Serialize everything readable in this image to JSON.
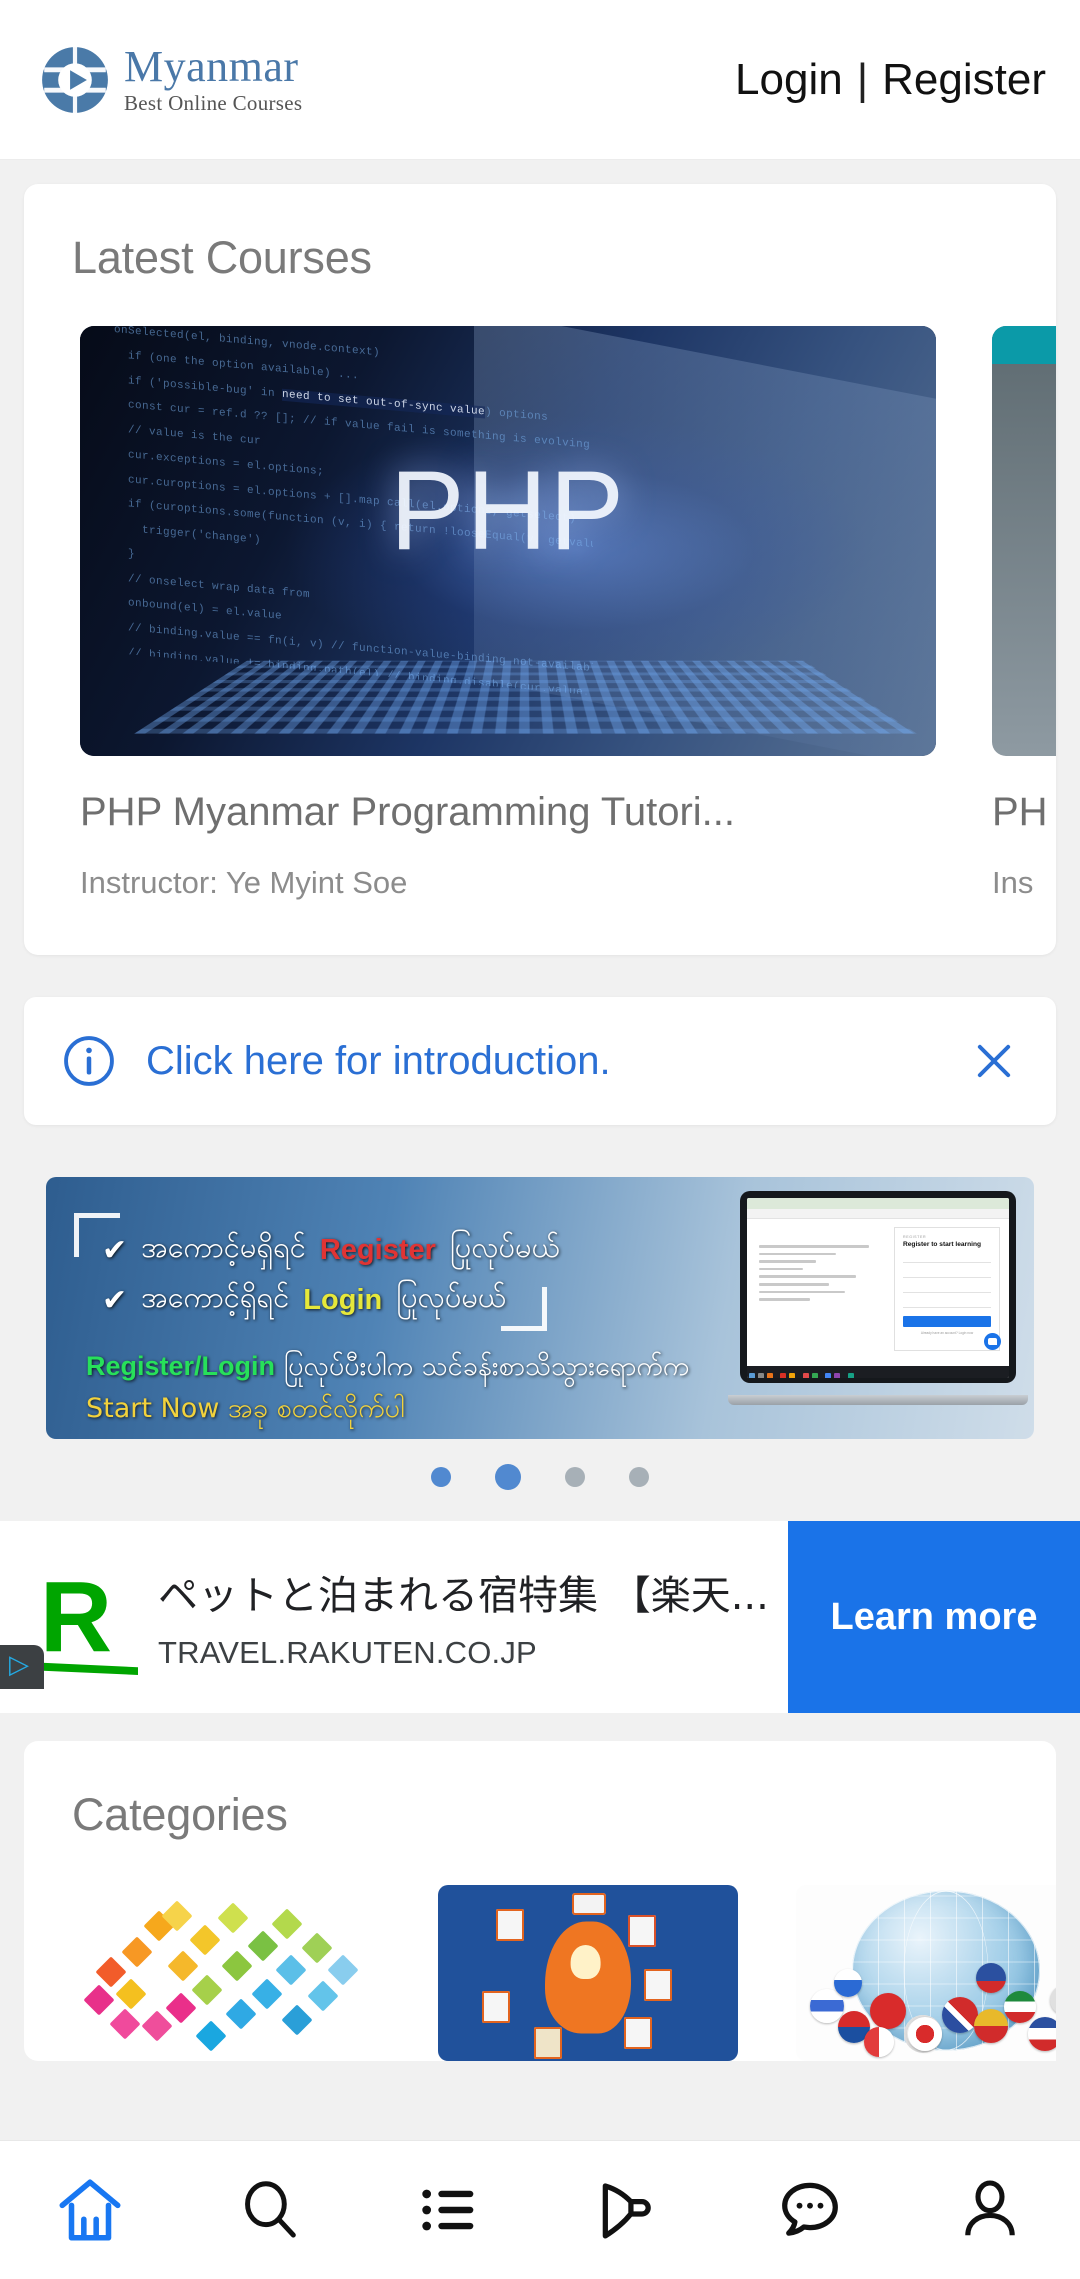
{
  "header": {
    "logo": {
      "icon": "globe-play-logo-icon",
      "title": "Myanmar",
      "subtitle": "Best Online Courses"
    },
    "login_label": "Login",
    "separator": "|",
    "register_label": "Register"
  },
  "latest_courses": {
    "section_title": "Latest Courses",
    "items": [
      {
        "thumb_text": "PHP",
        "title": "PHP Myanmar Programming Tutori...",
        "instructor": "Instructor: Ye Myint Soe"
      },
      {
        "thumb_text": "",
        "title": "PH",
        "instructor": "Ins"
      }
    ]
  },
  "alert": {
    "icon": "info-circle-icon",
    "message": "Click here for introduction.",
    "close_icon": "close-icon"
  },
  "promo": {
    "line1_prefix": "အကောင့်မရှိရင်",
    "line1_keyword": "Register",
    "line1_suffix": "ပြုလုပ်မယ်",
    "line2_prefix": "အကောင့်ရှိရင်",
    "line2_keyword": "Login",
    "line2_suffix": "ပြုလုပ်မယ်",
    "line3_keyword": "Register/Login",
    "line3_text": "ပြုလုပ်ပီးပါက သင်ခန်းစာသိသွားရောက်က",
    "line4_text": "Start Now အခု စတင်လိုက်ပါ",
    "tick_icon": "check-icon",
    "laptop": {
      "form_kicker": "REGISTER",
      "form_heading": "Register to start learning",
      "fields": [
        "User name",
        "Enter mail here",
        "Password",
        "Confirm Password"
      ],
      "submit_label": "Sign up",
      "footer_note": "Already have an account? Login now"
    },
    "dots": [
      {
        "state": "on"
      },
      {
        "state": "cur"
      },
      {
        "state": "off"
      },
      {
        "state": "off"
      }
    ]
  },
  "ad": {
    "logo_letter": "R",
    "adchoices_icon": "adchoices-icon",
    "headline": "ペットと泊まれる宿特集 【楽天...",
    "url": "TRAVEL.RAKUTEN.CO.JP",
    "cta_label": "Learn more"
  },
  "categories": {
    "section_title": "Categories",
    "items": [
      {
        "name": "colorful-mosaic-category"
      },
      {
        "name": "business-idea-category"
      },
      {
        "name": "languages-globe-category"
      }
    ]
  },
  "bottom_nav": {
    "items": [
      {
        "icon": "home-icon",
        "active": true
      },
      {
        "icon": "search-icon",
        "active": false
      },
      {
        "icon": "list-icon",
        "active": false
      },
      {
        "icon": "megaphone-icon",
        "active": false
      },
      {
        "icon": "chat-icon",
        "active": false
      },
      {
        "icon": "profile-icon",
        "active": false
      }
    ],
    "active_color": "#1877f2",
    "inactive_color": "#111111"
  }
}
